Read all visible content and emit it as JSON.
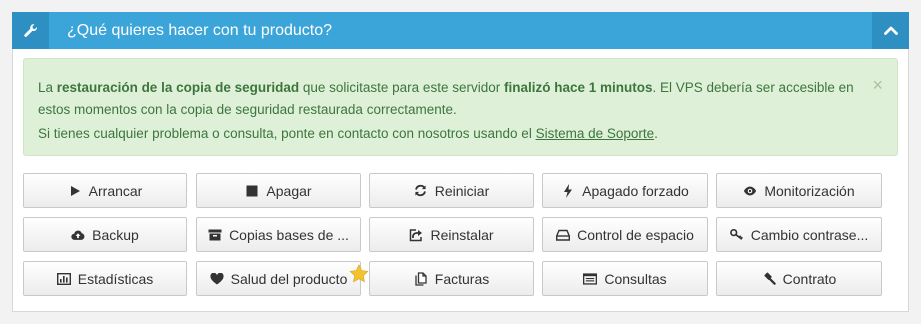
{
  "header": {
    "title": "¿Qué quieres hacer con tu producto?",
    "left_icon": "wrench-icon",
    "toggle_icon": "chevron-up-icon",
    "color": "#3ba5d9"
  },
  "alert": {
    "p1_a": "La ",
    "p1_b": "restauración de la copia de seguridad",
    "p1_c": " que solicitaste para este servidor ",
    "p1_d": "finalizó hace 1 minutos",
    "p1_e": ". El VPS debería ser accesible en estos momentos con la copia de seguridad restaurada correctamente.",
    "p2_a": "Si tienes cualquier problema o consulta, ponte en contacto con nosotros usando el ",
    "p2_link": "Sistema de Soporte",
    "p2_b": ".",
    "close": "×",
    "color": "#dff0d8"
  },
  "buttons": [
    {
      "label": "Arrancar",
      "icon": "play-icon"
    },
    {
      "label": "Apagar",
      "icon": "stop-icon"
    },
    {
      "label": "Reiniciar",
      "icon": "refresh-icon"
    },
    {
      "label": "Apagado forzado",
      "icon": "bolt-icon"
    },
    {
      "label": "Monitorización",
      "icon": "eye-icon"
    },
    {
      "label": "Backup",
      "icon": "cloud-upload-icon"
    },
    {
      "label": "Copias bases de ...",
      "icon": "archive-icon"
    },
    {
      "label": "Reinstalar",
      "icon": "share-icon"
    },
    {
      "label": "Control de espacio",
      "icon": "hdd-icon"
    },
    {
      "label": "Cambio contrase...",
      "icon": "key-icon"
    },
    {
      "label": "Estadísticas",
      "icon": "bar-chart-icon"
    },
    {
      "label": "Salud del producto",
      "icon": "heart-icon"
    },
    {
      "label": "Facturas",
      "icon": "copy-icon"
    },
    {
      "label": "Consultas",
      "icon": "list-icon"
    },
    {
      "label": "Contrato",
      "icon": "gavel-icon"
    }
  ],
  "favorite_icon": "star-icon"
}
